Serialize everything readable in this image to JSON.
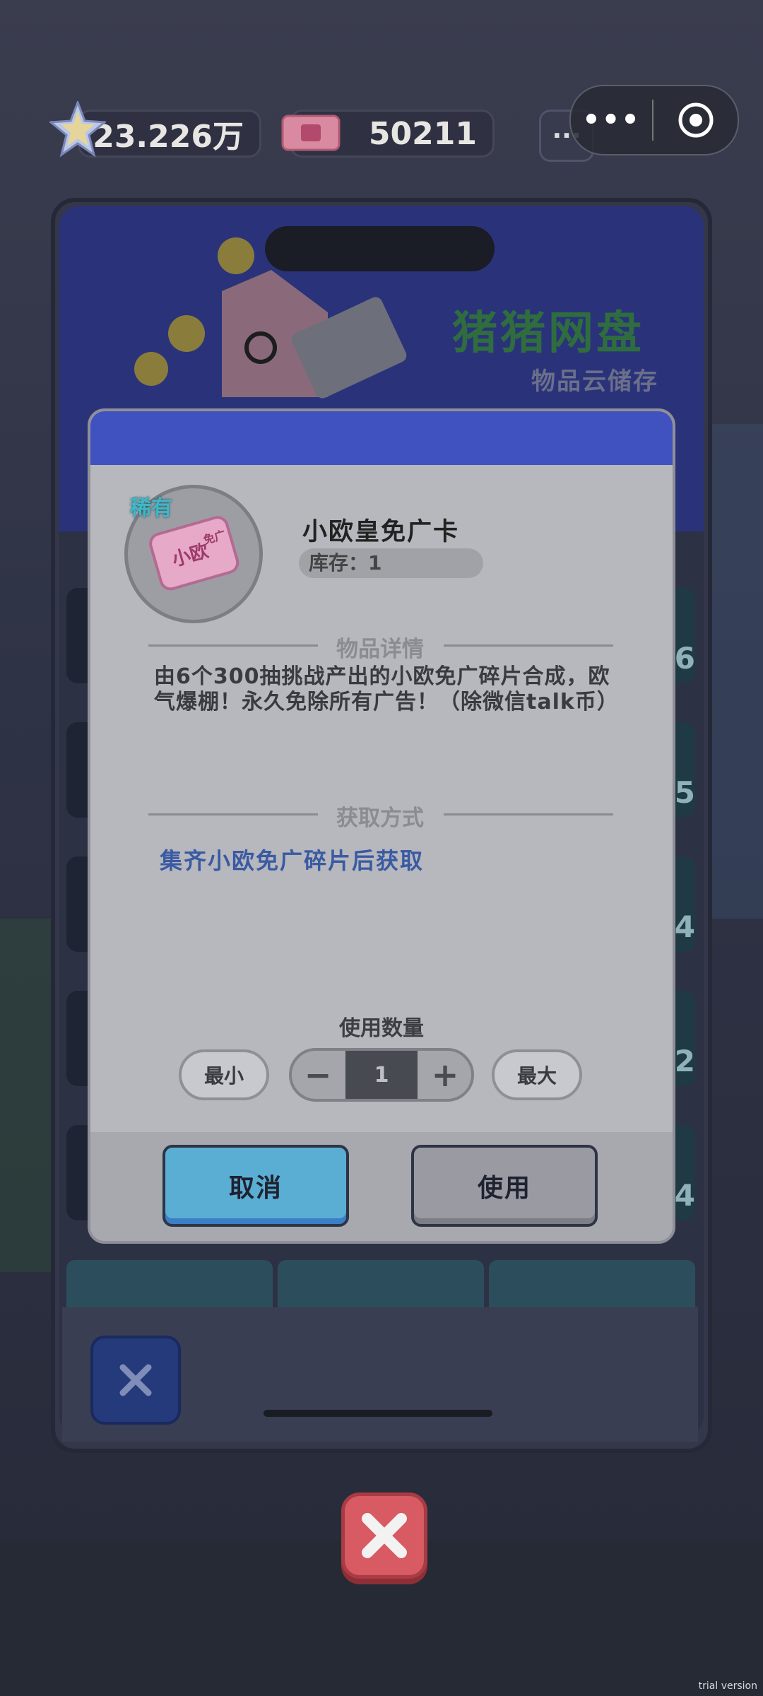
{
  "topbar": {
    "star_amount": "23.226万",
    "ticket_amount": "50211",
    "more_label": "···",
    "capsule_dots": "•••"
  },
  "panel": {
    "title": "猪猪网盘",
    "subtitle": "物品云储存",
    "right_slot_numbers": [
      "6",
      "35",
      "24",
      "2",
      "4"
    ]
  },
  "dialog": {
    "rarity": "稀有",
    "item_name": "小欧皇免广卡",
    "stock": "库存：1",
    "details_title": "物品详情",
    "description": "由6个300抽挑战产出的小欧免广碎片合成，欧气爆棚！永久免除所有广告！（除微信talk币）",
    "acquire_title": "获取方式",
    "acquire_text": "集齐小欧免广碎片后获取",
    "quantity_label": "使用数量",
    "min_label": "最小",
    "max_label": "最大",
    "quantity_value": "1",
    "minus_label": "−",
    "plus_label": "+",
    "cancel_label": "取消",
    "use_label": "使用",
    "item_icon_text": "小欧",
    "item_icon_sub": "免广"
  },
  "watermark": "trial version",
  "colors": {
    "dialog_header": "#3f52c0",
    "cancel_button": "#5aaed3",
    "close_button": "#d85a62"
  }
}
